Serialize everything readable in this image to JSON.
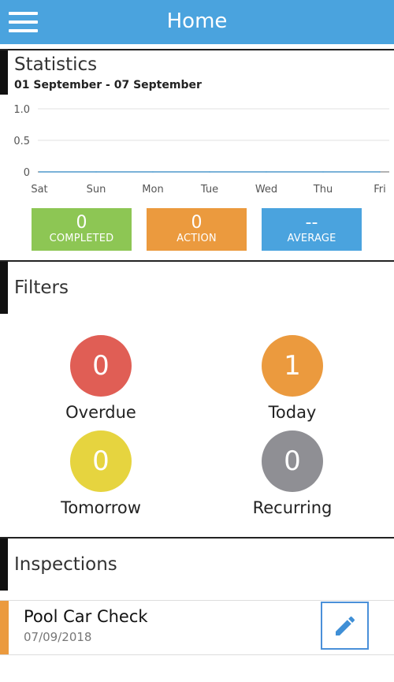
{
  "header": {
    "title": "Home",
    "menu_icon": "hamburger-menu-icon",
    "color": "#4aa3de"
  },
  "statistics": {
    "title": "Statistics",
    "date_range": "01 September - 07 September",
    "chart_data": {
      "type": "line",
      "categories": [
        "Sat",
        "Sun",
        "Mon",
        "Tue",
        "Wed",
        "Thu",
        "Fri"
      ],
      "series": [
        {
          "values": [
            0,
            0,
            0,
            0,
            0,
            0,
            0
          ]
        }
      ],
      "yticks": [
        "1.0",
        "0.5",
        "0"
      ],
      "ylim": [
        0,
        1
      ],
      "grid": true
    },
    "boxes": [
      {
        "value": "0",
        "label": "COMPLETED",
        "color": "#8dc654"
      },
      {
        "value": "0",
        "label": "ACTION",
        "color": "#eb9a3e"
      },
      {
        "value": "--",
        "label": "AVERAGE",
        "color": "#4aa3de"
      }
    ]
  },
  "filters": {
    "title": "Filters",
    "items": [
      {
        "count": "0",
        "label": "Overdue",
        "color": "#e05e55"
      },
      {
        "count": "1",
        "label": "Today",
        "color": "#eb9a3e"
      },
      {
        "count": "0",
        "label": "Tomorrow",
        "color": "#e6d43f"
      },
      {
        "count": "0",
        "label": "Recurring",
        "color": "#8f8f94"
      }
    ]
  },
  "inspections": {
    "title": "Inspections",
    "items": [
      {
        "name": "Pool Car Check",
        "date": "07/09/2018",
        "accent": "#eb9a3e",
        "action_icon": "edit-pencil-icon"
      }
    ]
  }
}
